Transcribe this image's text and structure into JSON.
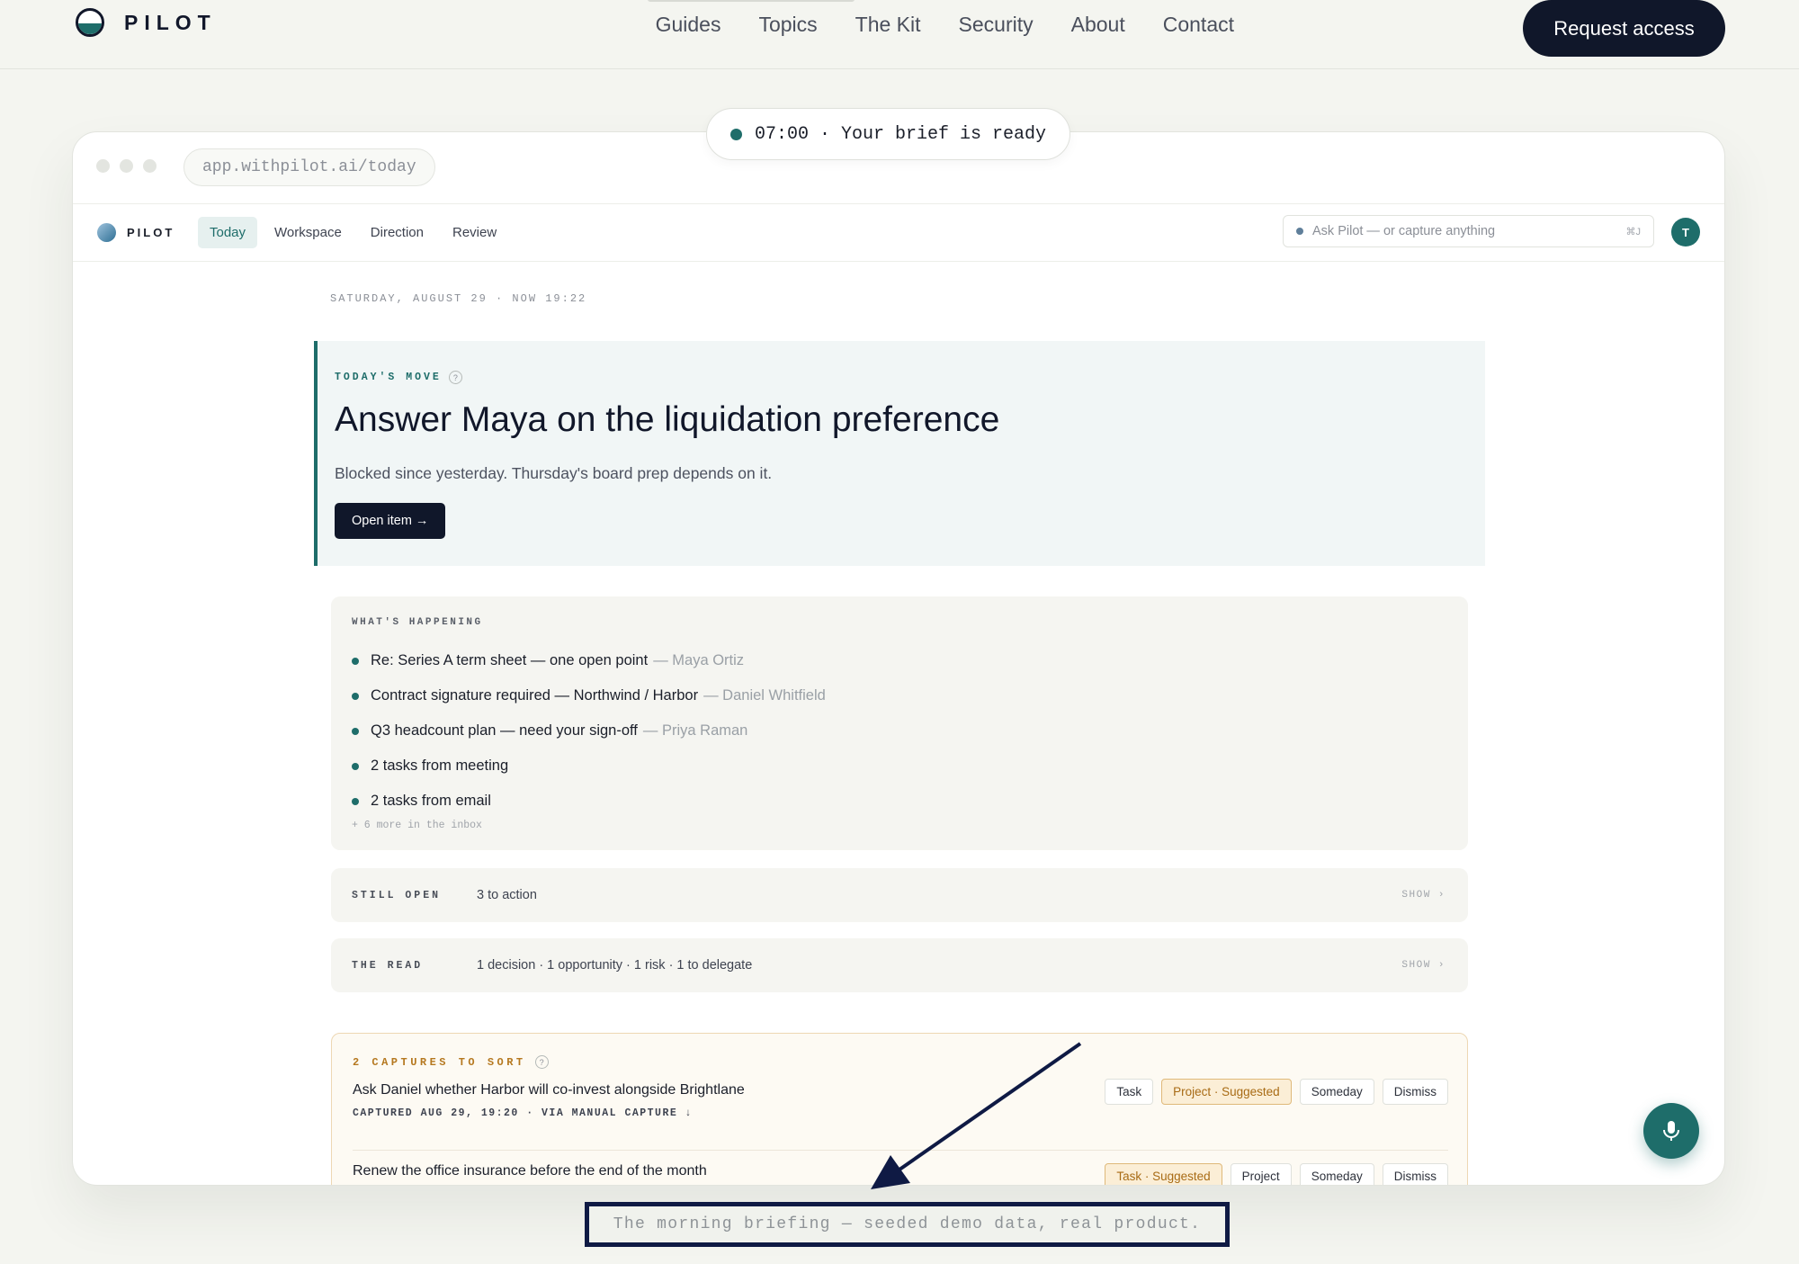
{
  "site": {
    "logo_text": "PILOT",
    "nav": [
      "Guides",
      "Topics",
      "The Kit",
      "Security",
      "About",
      "Contact"
    ],
    "cta": "Request access"
  },
  "browser": {
    "url": "app.withpilot.ai/today",
    "brief_pill": "07:00 · Your brief is ready"
  },
  "app": {
    "logo_text": "PILOT",
    "tabs": [
      "Today",
      "Workspace",
      "Direction",
      "Review"
    ],
    "active_tab": "Today",
    "ask_placeholder": "Ask Pilot — or capture anything",
    "ask_shortcut": "⌘J",
    "avatar_initial": "T"
  },
  "today": {
    "date_line": "SATURDAY, AUGUST 29 · NOW 19:22",
    "move": {
      "kicker": "TODAY'S MOVE",
      "title": "Answer Maya on the liquidation preference",
      "subtitle": "Blocked since yesterday. Thursday's board prep depends on it.",
      "button": "Open item →"
    },
    "happening": {
      "kicker": "WHAT'S HAPPENING",
      "items": [
        {
          "text": "Re: Series A term sheet — one open point",
          "who": "— Maya Ortiz"
        },
        {
          "text": "Contract signature required — Northwind / Harbor",
          "who": "— Daniel Whitfield"
        },
        {
          "text": "Q3 headcount plan — need your sign-off",
          "who": "— Priya Raman"
        },
        {
          "text": "2 tasks from meeting",
          "who": ""
        },
        {
          "text": "2 tasks from email",
          "who": ""
        }
      ],
      "more": "+ 6 more in the inbox"
    },
    "still_open": {
      "kicker": "STILL OPEN",
      "value": "3 to action",
      "show": "SHOW ›"
    },
    "the_read": {
      "kicker": "THE READ",
      "value": "1 decision · 1 opportunity · 1 risk · 1 to delegate",
      "show": "SHOW ›"
    },
    "captures": {
      "kicker": "2 CAPTURES TO SORT",
      "items": [
        {
          "title": "Ask Daniel whether Harbor will co-invest alongside Brightlane",
          "meta": "CAPTURED AUG 29, 19:20 · VIA MANUAL CAPTURE ↓",
          "chips": [
            "Task",
            "Project · Suggested",
            "Someday",
            "Dismiss"
          ]
        },
        {
          "title": "Renew the office insurance before the end of the month",
          "meta": "",
          "chips": [
            "Task · Suggested",
            "Project",
            "Someday",
            "Dismiss"
          ]
        }
      ]
    }
  },
  "caption": "The morning briefing — seeded demo data, real product.",
  "colors": {
    "accent": "#1e6d6a",
    "ink": "#10172a",
    "suggested": "#b5781f",
    "annotation": "#0f1a44"
  },
  "icons": [
    "pilot-logo-icon",
    "status-dot-icon",
    "help-icon",
    "microphone-icon",
    "arrow-icon"
  ]
}
